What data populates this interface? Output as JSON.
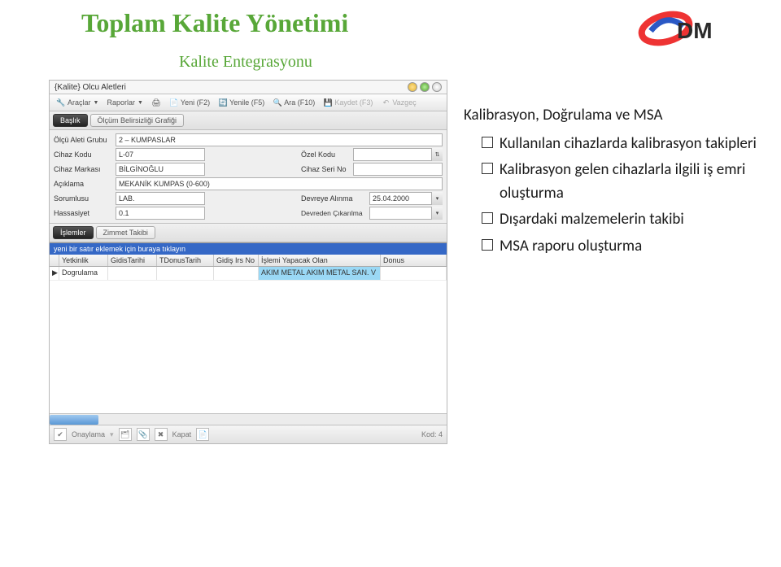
{
  "page": {
    "main_title": "Toplam Kalite Yönetimi",
    "sub_title": "Kalite Entegrasyonu"
  },
  "logo": {
    "text": "DM"
  },
  "window": {
    "title": "{Kalite} Olcu Aletleri"
  },
  "toolbar": {
    "tools": "Araçlar",
    "reports": "Raporlar",
    "new": "Yeni (F2)",
    "refresh": "Yenile (F5)",
    "search": "Ara (F10)",
    "save": "Kaydet (F3)",
    "cancel": "Vazgeç"
  },
  "tabs": {
    "header": "Başlık",
    "graph": "Ölçüm Belirsizliği Grafiği"
  },
  "form": {
    "group_label": "Ölçü Aleti Grubu",
    "group_value": "2 – KUMPASLAR",
    "device_code_label": "Cihaz Kodu",
    "device_code_value": "L-07",
    "special_code_label": "Özel Kodu",
    "special_code_value": "",
    "brand_label": "Cihaz Markası",
    "brand_value": "BİLGİNOĞLU",
    "serial_label": "Cihaz Seri No",
    "serial_value": "",
    "desc_label": "Açıklama",
    "desc_value": "MEKANİK KUMPAS (0-600)",
    "resp_label": "Sorumlusu",
    "resp_value": "LAB.",
    "commission_label": "Devreye Alınma",
    "commission_value": "25.04.2000",
    "sens_label": "Hassasiyet",
    "sens_value": "0.1",
    "decommission_label": "Devreden Çıkarılma",
    "decommission_value": ""
  },
  "subtabs": {
    "ops": "İşlemler",
    "track": "Zimmet Takibi"
  },
  "grid": {
    "new_row": "yeni bir satır eklemek için buraya tıklayın",
    "headers": {
      "capability": "Yetkinlik",
      "go_date": "GidisTarihi",
      "return_date": "TDonusTarih",
      "go_work": "Gidiş Irs No",
      "performer": "İşlemi Yapacak Olan",
      "ret": "Donus"
    },
    "row": {
      "capability": "Dogrulama",
      "go_date": "",
      "return_date": "",
      "go_work": "",
      "performer": "AKIM METAL AKIM METAL SAN. V",
      "ret": ""
    }
  },
  "statusbar": {
    "approve": "Onaylama",
    "close": "Kapat",
    "code": "Kod: 4"
  },
  "right": {
    "title": "Kalibrasyon, Doğrulama ve MSA",
    "item1": "Kullanılan cihazlarda kalibrasyon takipleri",
    "item2": "Kalibrasyon gelen cihazlarla ilgili iş emri oluşturma",
    "item3": "Dışardaki malzemelerin takibi",
    "item4": "MSA raporu oluşturma"
  }
}
